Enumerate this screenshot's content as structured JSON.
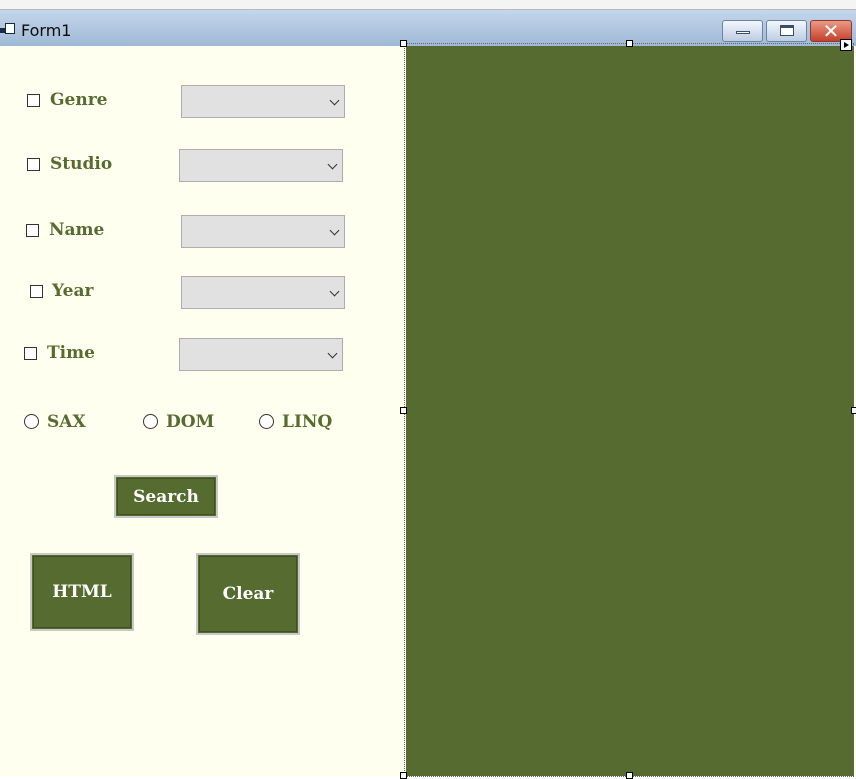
{
  "window": {
    "title": "Form1"
  },
  "filters": [
    {
      "label": "Genre",
      "checked": false,
      "value": ""
    },
    {
      "label": "Studio",
      "checked": false,
      "value": ""
    },
    {
      "label": "Name",
      "checked": false,
      "value": ""
    },
    {
      "label": "Year",
      "checked": false,
      "value": ""
    },
    {
      "label": "Time",
      "checked": false,
      "value": ""
    }
  ],
  "parsers": [
    {
      "label": "SAX",
      "selected": false
    },
    {
      "label": "DOM",
      "selected": false
    },
    {
      "label": "LINQ",
      "selected": false
    }
  ],
  "buttons": {
    "search": "Search",
    "html": "HTML",
    "clear": "Clear"
  },
  "colors": {
    "accent": "#556b2f",
    "form_background": "#fffff0",
    "combo_background": "#e1e1e1"
  },
  "icons": [
    "app-icon",
    "minimize-icon",
    "maximize-icon",
    "close-icon",
    "chevron-down-icon",
    "smart-tag-arrow-icon"
  ]
}
